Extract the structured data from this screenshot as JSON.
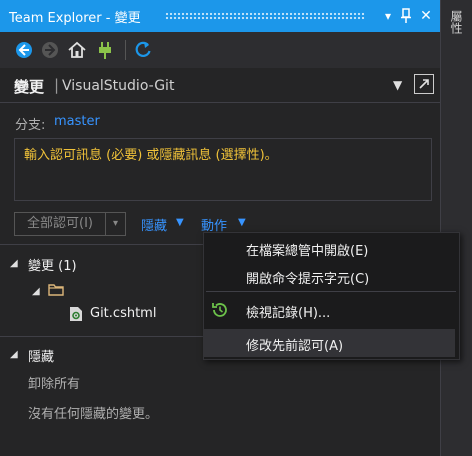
{
  "window": {
    "title": "Team Explorer - 變更",
    "dropdown_icon": "▾",
    "pin_icon": "pin-icon",
    "close_icon": "✕",
    "side_tab": "屬性"
  },
  "toolbar": {
    "back": "back-icon",
    "forward": "forward-icon",
    "home": "home-icon",
    "connect": "plug-icon",
    "refresh": "refresh-icon"
  },
  "header": {
    "title": "變更",
    "separator": "|",
    "repo": "VisualStudio-Git",
    "caret": "▼"
  },
  "branch": {
    "label": "分支:",
    "value": "master"
  },
  "message": {
    "placeholder": "輸入認可訊息 (必要) 或隱藏訊息 (選擇性)。"
  },
  "commit": {
    "button": "全部認可(I)",
    "caret": "▾",
    "stash": "隱藏",
    "action": "動作",
    "link_caret": "▼"
  },
  "changes": {
    "label": "變更 (1)",
    "expand": "◢",
    "file": "Git.cshtml"
  },
  "stashes": {
    "label": "隱藏",
    "expand": "◢",
    "drop_all": "卸除所有",
    "empty": "沒有任何隱藏的變更。"
  },
  "menu": {
    "items": [
      "在檔案總管中開啟(E)",
      "開啟命令提示字元(C)",
      "檢視記錄(H)...",
      "修改先前認可(A)"
    ]
  },
  "colors": {
    "accent": "#1c97ea",
    "link": "#3794ff",
    "warning_text": "#f0c239",
    "background": "#252526"
  }
}
